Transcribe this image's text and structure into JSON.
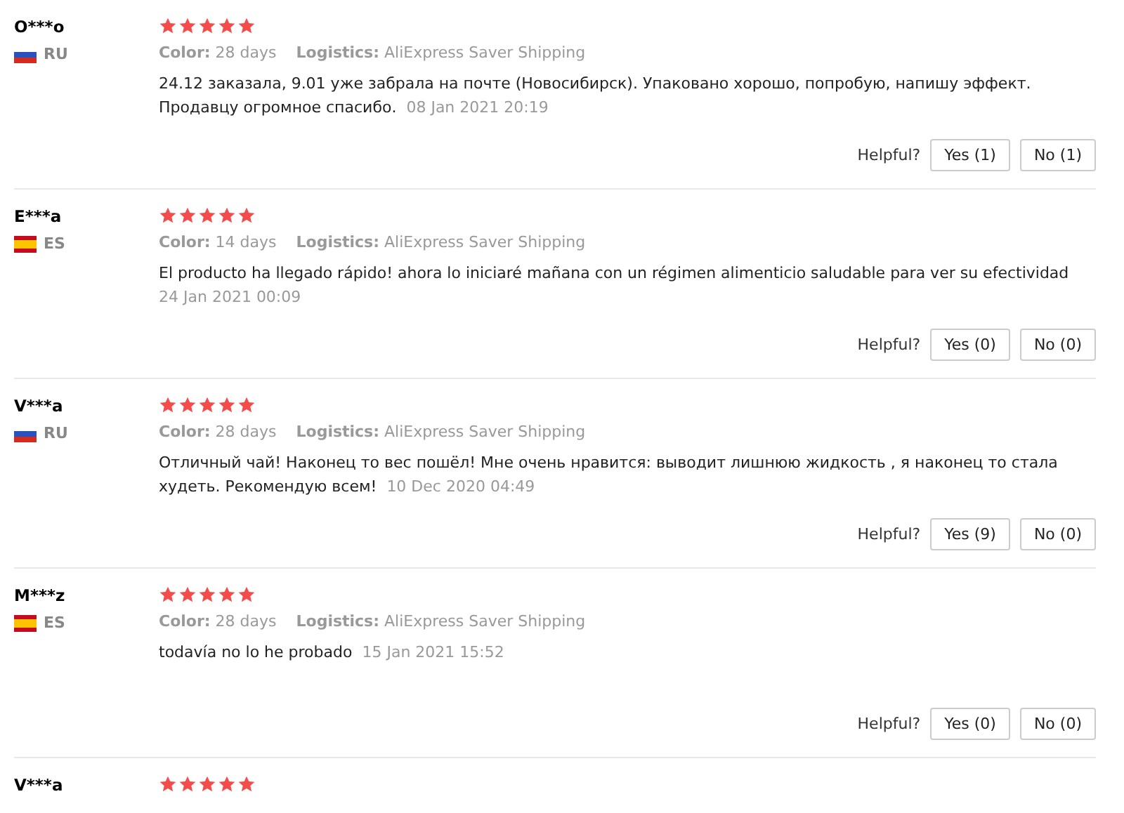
{
  "reviews": [
    {
      "name": "O***o",
      "flag": {
        "kind": "ru"
      },
      "country": "RU",
      "stars": 5,
      "color_label": "Color:",
      "color_value": "28 days",
      "logistics_label": "Logistics:",
      "logistics_value": "AliExpress Saver Shipping",
      "text": "24.12 заказала, 9.01 уже забрала на почте (Новосибирск). Упаковано хорошо, попробую, напишу эффект. Продавцу огромное спасибо.",
      "date": "08 Jan 2021 20:19",
      "helpful": "Helpful?",
      "yes": "Yes (1)",
      "no": "No (1)"
    },
    {
      "name": "E***a",
      "flag": {
        "kind": "es"
      },
      "country": "ES",
      "stars": 5,
      "color_label": "Color:",
      "color_value": "14 days",
      "logistics_label": "Logistics:",
      "logistics_value": "AliExpress Saver Shipping",
      "text": "El producto ha llegado rápido! ahora lo iniciaré mañana con un régimen alimenticio saludable para ver su efectividad",
      "date": "24 Jan 2021 00:09",
      "helpful": "Helpful?",
      "yes": "Yes (0)",
      "no": "No (0)"
    },
    {
      "name": "V***a",
      "flag": {
        "kind": "ru"
      },
      "country": "RU",
      "stars": 5,
      "color_label": "Color:",
      "color_value": "28 days",
      "logistics_label": "Logistics:",
      "logistics_value": "AliExpress Saver Shipping",
      "text": "Отличный чай! Наконец то вес пошёл! Мне очень нравится: выводит лишнюю жидкость , я наконец то стала худеть. Рекомендую всем!",
      "date": "10 Dec 2020 04:49",
      "helpful": "Helpful?",
      "yes": "Yes (9)",
      "no": "No (0)"
    },
    {
      "name": "M***z",
      "flag": {
        "kind": "es"
      },
      "country": "ES",
      "stars": 5,
      "color_label": "Color:",
      "color_value": "28 days",
      "logistics_label": "Logistics:",
      "logistics_value": "AliExpress Saver Shipping",
      "text": "todavía no lo he probado",
      "date": "15 Jan 2021 15:52",
      "helpful": "Helpful?",
      "yes": "Yes (0)",
      "no": "No (0)"
    },
    {
      "name": "V***a",
      "stars": 5
    }
  ]
}
